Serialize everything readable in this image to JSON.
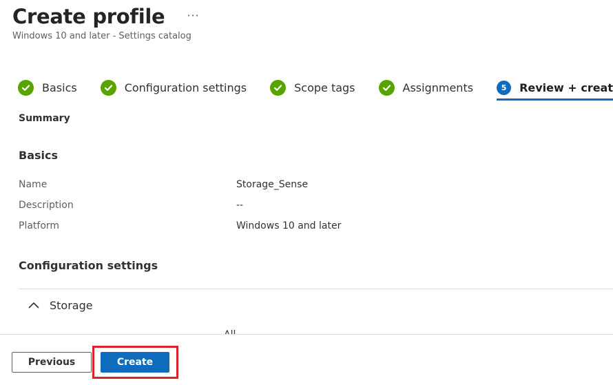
{
  "header": {
    "title": "Create profile",
    "more_label": "···",
    "subtitle": "Windows 10 and later - Settings catalog"
  },
  "steps": [
    {
      "label": "Basics",
      "state": "complete"
    },
    {
      "label": "Configuration settings",
      "state": "complete"
    },
    {
      "label": "Scope tags",
      "state": "complete"
    },
    {
      "label": "Assignments",
      "state": "complete"
    },
    {
      "label": "Review + create",
      "state": "active",
      "number": "5"
    }
  ],
  "summary": {
    "label": "Summary",
    "basics": {
      "heading": "Basics",
      "rows": [
        {
          "key": "Name",
          "value": "Storage_Sense"
        },
        {
          "key": "Description",
          "value": "--"
        },
        {
          "key": "Platform",
          "value": "Windows 10 and later"
        }
      ]
    },
    "configuration": {
      "heading": "Configuration settings",
      "groups": [
        {
          "label": "Storage",
          "expanded": true,
          "partial_value": "All"
        }
      ]
    }
  },
  "footer": {
    "previous_label": "Previous",
    "create_label": "Create"
  },
  "colors": {
    "accent": "#0f6cbd",
    "success": "#57a300",
    "highlight": "#d9222a"
  }
}
